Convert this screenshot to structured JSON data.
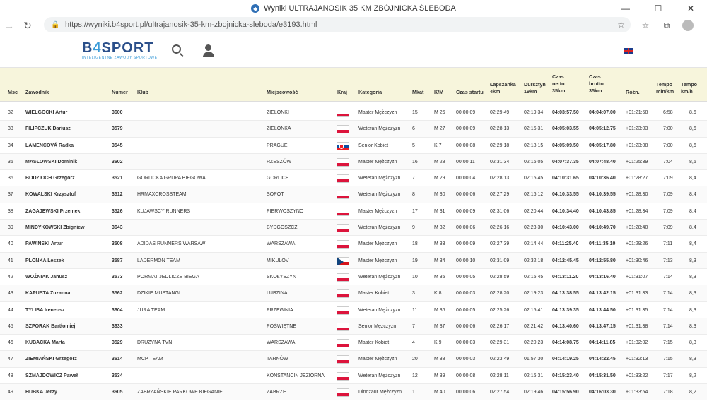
{
  "window": {
    "title": "Wyniki ULTRAJANOSIK 35 KM ZBÓJNICKA ŚLEBODA"
  },
  "browser": {
    "url": "https://wyniki.b4sport.pl/ultrajanosik-35-km-zbojnicka-sleboda/e3193.html"
  },
  "site": {
    "brand_prefix": "B",
    "brand_four": "4",
    "brand_suffix": "SPORT",
    "tagline": "INTELIGENTNE ZAWODY SPORTOWE"
  },
  "columns": {
    "msc": "Msc",
    "zawodnik": "Zawodnik",
    "numer": "Numer",
    "klub": "Klub",
    "miejscowosc": "Miejscowość",
    "kraj": "Kraj",
    "kategoria": "Kategoria",
    "mkat": "Mkat",
    "km": "K/M",
    "start": "Czas startu",
    "lap1": "Łapszanka",
    "lap1b": "4km",
    "lap2": "Dursztyn",
    "lap2b": "19km",
    "netto": "Czas",
    "nettob": "netto",
    "nettoc": "35km",
    "brutto": "Czas",
    "bruttob": "brutto",
    "bruttoc": "35km",
    "rozn": "Różn.",
    "tempo": "Tempo",
    "tempob": "min/km",
    "tempo2": "Tempo",
    "tempo2b": "km/h"
  },
  "rows": [
    {
      "msc": "32",
      "name": "WIELGOCKI Artur",
      "num": "3600",
      "club": "",
      "city": "ZIELONKI",
      "flag": "pl",
      "cat": "Master Mężczyzn",
      "mkat": "15",
      "km": "M 26",
      "start": "00:00:09",
      "l1": "02:29:49",
      "l2": "02:19:34",
      "netto": "04:03:57.50",
      "brutto": "04:04:07.00",
      "rozn": "+01:21:58",
      "tempo": "6:58",
      "kmh": "8,6"
    },
    {
      "msc": "33",
      "name": "FILIPCZUK Dariusz",
      "num": "3579",
      "club": "",
      "city": "ZIELONKA",
      "flag": "pl",
      "cat": "Weteran Mężczyzn",
      "mkat": "6",
      "km": "M 27",
      "start": "00:00:09",
      "l1": "02:28:13",
      "l2": "02:16:31",
      "netto": "04:05:03.55",
      "brutto": "04:05:12.75",
      "rozn": "+01:23:03",
      "tempo": "7:00",
      "kmh": "8,6"
    },
    {
      "msc": "34",
      "name": "LAMENCOVÁ Radka",
      "num": "3545",
      "club": "",
      "city": "PRAGUE",
      "flag": "sk",
      "cat": "Senior Kobiet",
      "mkat": "5",
      "km": "K 7",
      "start": "00:00:08",
      "l1": "02:29:18",
      "l2": "02:18:15",
      "netto": "04:05:09.50",
      "brutto": "04:05:17.80",
      "rozn": "+01:23:08",
      "tempo": "7:00",
      "kmh": "8,6"
    },
    {
      "msc": "35",
      "name": "MASŁOWSKI Dominik",
      "num": "3602",
      "club": "",
      "city": "RZESZÓW",
      "flag": "pl",
      "cat": "Master Mężczyzn",
      "mkat": "16",
      "km": "M 28",
      "start": "00:00:11",
      "l1": "02:31:34",
      "l2": "02:16:05",
      "netto": "04:07:37.35",
      "brutto": "04:07:48.40",
      "rozn": "+01:25:39",
      "tempo": "7:04",
      "kmh": "8,5"
    },
    {
      "msc": "36",
      "name": "BODZIOCH Grzegorz",
      "num": "3521",
      "club": "GORLICKA GRUPA BIEGOWA",
      "city": "GORLICE",
      "flag": "pl",
      "cat": "Weteran Mężczyzn",
      "mkat": "7",
      "km": "M 29",
      "start": "00:00:04",
      "l1": "02:28:13",
      "l2": "02:15:45",
      "netto": "04:10:31.65",
      "brutto": "04:10:36.40",
      "rozn": "+01:28:27",
      "tempo": "7:09",
      "kmh": "8,4"
    },
    {
      "msc": "37",
      "name": "KOWALSKI Krzysztof",
      "num": "3512",
      "club": "HRMAXCROSSTEAM",
      "city": "SOPOT",
      "flag": "pl",
      "cat": "Weteran Mężczyzn",
      "mkat": "8",
      "km": "M 30",
      "start": "00:00:06",
      "l1": "02:27:29",
      "l2": "02:16:12",
      "netto": "04:10:33.55",
      "brutto": "04:10:39.55",
      "rozn": "+01:28:30",
      "tempo": "7:09",
      "kmh": "8,4"
    },
    {
      "msc": "38",
      "name": "ZAGAJEWSKI Przemek",
      "num": "3526",
      "club": "KUJAWSCY RUNNERS",
      "city": "PIERWOSZYNO",
      "flag": "pl",
      "cat": "Master Mężczyzn",
      "mkat": "17",
      "km": "M 31",
      "start": "00:00:09",
      "l1": "02:31:06",
      "l2": "02:20:44",
      "netto": "04:10:34.40",
      "brutto": "04:10:43.85",
      "rozn": "+01:28:34",
      "tempo": "7:09",
      "kmh": "8,4"
    },
    {
      "msc": "39",
      "name": "MINDYKOWSKI Zbigniew",
      "num": "3643",
      "club": "",
      "city": "BYDGOSZCZ",
      "flag": "pl",
      "cat": "Weteran Mężczyzn",
      "mkat": "9",
      "km": "M 32",
      "start": "00:00:06",
      "l1": "02:26:16",
      "l2": "02:23:30",
      "netto": "04:10:43.00",
      "brutto": "04:10:49.70",
      "rozn": "+01:28:40",
      "tempo": "7:09",
      "kmh": "8,4"
    },
    {
      "msc": "40",
      "name": "PAWIŃSKI Artur",
      "num": "3508",
      "club": "ADIDAS RUNNERS WARSAW",
      "city": "WARSZAWA",
      "flag": "pl",
      "cat": "Master Mężczyzn",
      "mkat": "18",
      "km": "M 33",
      "start": "00:00:09",
      "l1": "02:27:39",
      "l2": "02:14:44",
      "netto": "04:11:25.40",
      "brutto": "04:11:35.10",
      "rozn": "+01:29:26",
      "tempo": "7:11",
      "kmh": "8,4"
    },
    {
      "msc": "41",
      "name": "PLONKA Leszek",
      "num": "3587",
      "club": "LADERMON TEAM",
      "city": "MIKULOV",
      "flag": "cz",
      "cat": "Master Mężczyzn",
      "mkat": "19",
      "km": "M 34",
      "start": "00:00:10",
      "l1": "02:31:09",
      "l2": "02:32:18",
      "netto": "04:12:45.45",
      "brutto": "04:12:55.80",
      "rozn": "+01:30:46",
      "tempo": "7:13",
      "kmh": "8,3"
    },
    {
      "msc": "42",
      "name": "WOŹNIAK Janusz",
      "num": "3573",
      "club": "PORMAT JEDLICZE BIEGA",
      "city": "SKOŁYSZYN",
      "flag": "pl",
      "cat": "Weteran Mężczyzn",
      "mkat": "10",
      "km": "M 35",
      "start": "00:00:05",
      "l1": "02:28:59",
      "l2": "02:15:45",
      "netto": "04:13:11.20",
      "brutto": "04:13:16.40",
      "rozn": "+01:31:07",
      "tempo": "7:14",
      "kmh": "8,3"
    },
    {
      "msc": "43",
      "name": "KAPUSTA Zuzanna",
      "num": "3562",
      "club": "DZIKIE MUSTANGI",
      "city": "LUBZINA",
      "flag": "pl",
      "cat": "Master Kobiet",
      "mkat": "3",
      "km": "K 8",
      "start": "00:00:03",
      "l1": "02:28:20",
      "l2": "02:19:23",
      "netto": "04:13:38.55",
      "brutto": "04:13:42.15",
      "rozn": "+01:31:33",
      "tempo": "7:14",
      "kmh": "8,3"
    },
    {
      "msc": "44",
      "name": "TYLIBA Ireneusz",
      "num": "3604",
      "club": "JURA TEAM",
      "city": "PRZEGINIA",
      "flag": "pl",
      "cat": "Weteran Mężczyzn",
      "mkat": "11",
      "km": "M 36",
      "start": "00:00:05",
      "l1": "02:25:26",
      "l2": "02:15:41",
      "netto": "04:13:39.35",
      "brutto": "04:13:44.50",
      "rozn": "+01:31:35",
      "tempo": "7:14",
      "kmh": "8,3"
    },
    {
      "msc": "45",
      "name": "SZPORAK Bartłomiej",
      "num": "3633",
      "club": "",
      "city": "POŚWIĘTNE",
      "flag": "pl",
      "cat": "Senior Mężczyzn",
      "mkat": "7",
      "km": "M 37",
      "start": "00:00:06",
      "l1": "02:26:17",
      "l2": "02:21:42",
      "netto": "04:13:40.60",
      "brutto": "04:13:47.15",
      "rozn": "+01:31:38",
      "tempo": "7:14",
      "kmh": "8,3"
    },
    {
      "msc": "46",
      "name": "KUBACKA Marta",
      "num": "3529",
      "club": "DRUZYNA TVN",
      "city": "WARSZAWA",
      "flag": "pl",
      "cat": "Master Kobiet",
      "mkat": "4",
      "km": "K 9",
      "start": "00:00:03",
      "l1": "02:29:31",
      "l2": "02:20:23",
      "netto": "04:14:08.75",
      "brutto": "04:14:11.85",
      "rozn": "+01:32:02",
      "tempo": "7:15",
      "kmh": "8,3"
    },
    {
      "msc": "47",
      "name": "ZIEMIAŃSKI Grzegorz",
      "num": "3614",
      "club": "MCP TEAM",
      "city": "TARNÓW",
      "flag": "pl",
      "cat": "Master Mężczyzn",
      "mkat": "20",
      "km": "M 38",
      "start": "00:00:03",
      "l1": "02:23:49",
      "l2": "01:57:30",
      "netto": "04:14:19.25",
      "brutto": "04:14:22.45",
      "rozn": "+01:32:13",
      "tempo": "7:15",
      "kmh": "8,3"
    },
    {
      "msc": "48",
      "name": "SZMAJDOWICZ Paweł",
      "num": "3534",
      "club": "",
      "city": "KONSTANCIN JEZIORNA",
      "flag": "pl",
      "cat": "Weteran Mężczyzn",
      "mkat": "12",
      "km": "M 39",
      "start": "00:00:08",
      "l1": "02:28:11",
      "l2": "02:16:31",
      "netto": "04:15:23.40",
      "brutto": "04:15:31.50",
      "rozn": "+01:33:22",
      "tempo": "7:17",
      "kmh": "8,2"
    },
    {
      "msc": "49",
      "name": "HUBKA Jerzy",
      "num": "3605",
      "club": "ZABRZAŃSKIE PARKOWE BIEGANIE",
      "city": "ZABRZE",
      "flag": "pl",
      "cat": "Dinozaur Mężczyzn",
      "mkat": "1",
      "km": "M 40",
      "start": "00:00:06",
      "l1": "02:27:54",
      "l2": "02:19:46",
      "netto": "04:15:56.90",
      "brutto": "04:16:03.30",
      "rozn": "+01:33:54",
      "tempo": "7:18",
      "kmh": "8,2"
    }
  ]
}
